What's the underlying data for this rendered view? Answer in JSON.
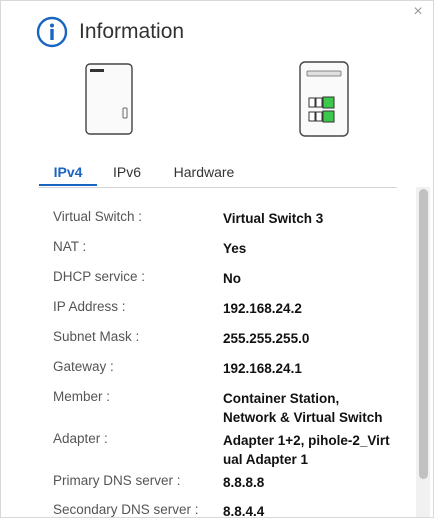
{
  "dialog": {
    "title": "Information",
    "close_glyph": "×",
    "title_icon": "info-icon",
    "accent_color": "#1a65c0"
  },
  "tabs": [
    {
      "label": "IPv4",
      "active": true
    },
    {
      "label": "IPv6",
      "active": false
    },
    {
      "label": "Hardware",
      "active": false
    }
  ],
  "details": [
    {
      "label": "Virtual Switch :",
      "value": "Virtual Switch 3"
    },
    {
      "label": "NAT :",
      "value": "Yes"
    },
    {
      "label": "DHCP service :",
      "value": "No"
    },
    {
      "label": "IP Address :",
      "value": "192.168.24.2"
    },
    {
      "label": "Subnet Mask :",
      "value": "255.255.255.0"
    },
    {
      "label": "Gateway :",
      "value": "192.168.24.1"
    },
    {
      "label": "Member :",
      "value": "Container Station, Network & Virtual Switch"
    },
    {
      "label": "Adapter :",
      "value": "Adapter 1+2, pihole-2_Virtual Adapter 1"
    },
    {
      "label": "Primary DNS server :",
      "value": "8.8.8.8"
    },
    {
      "label": "Secondary DNS server :",
      "value": "8.8.4.4"
    }
  ]
}
